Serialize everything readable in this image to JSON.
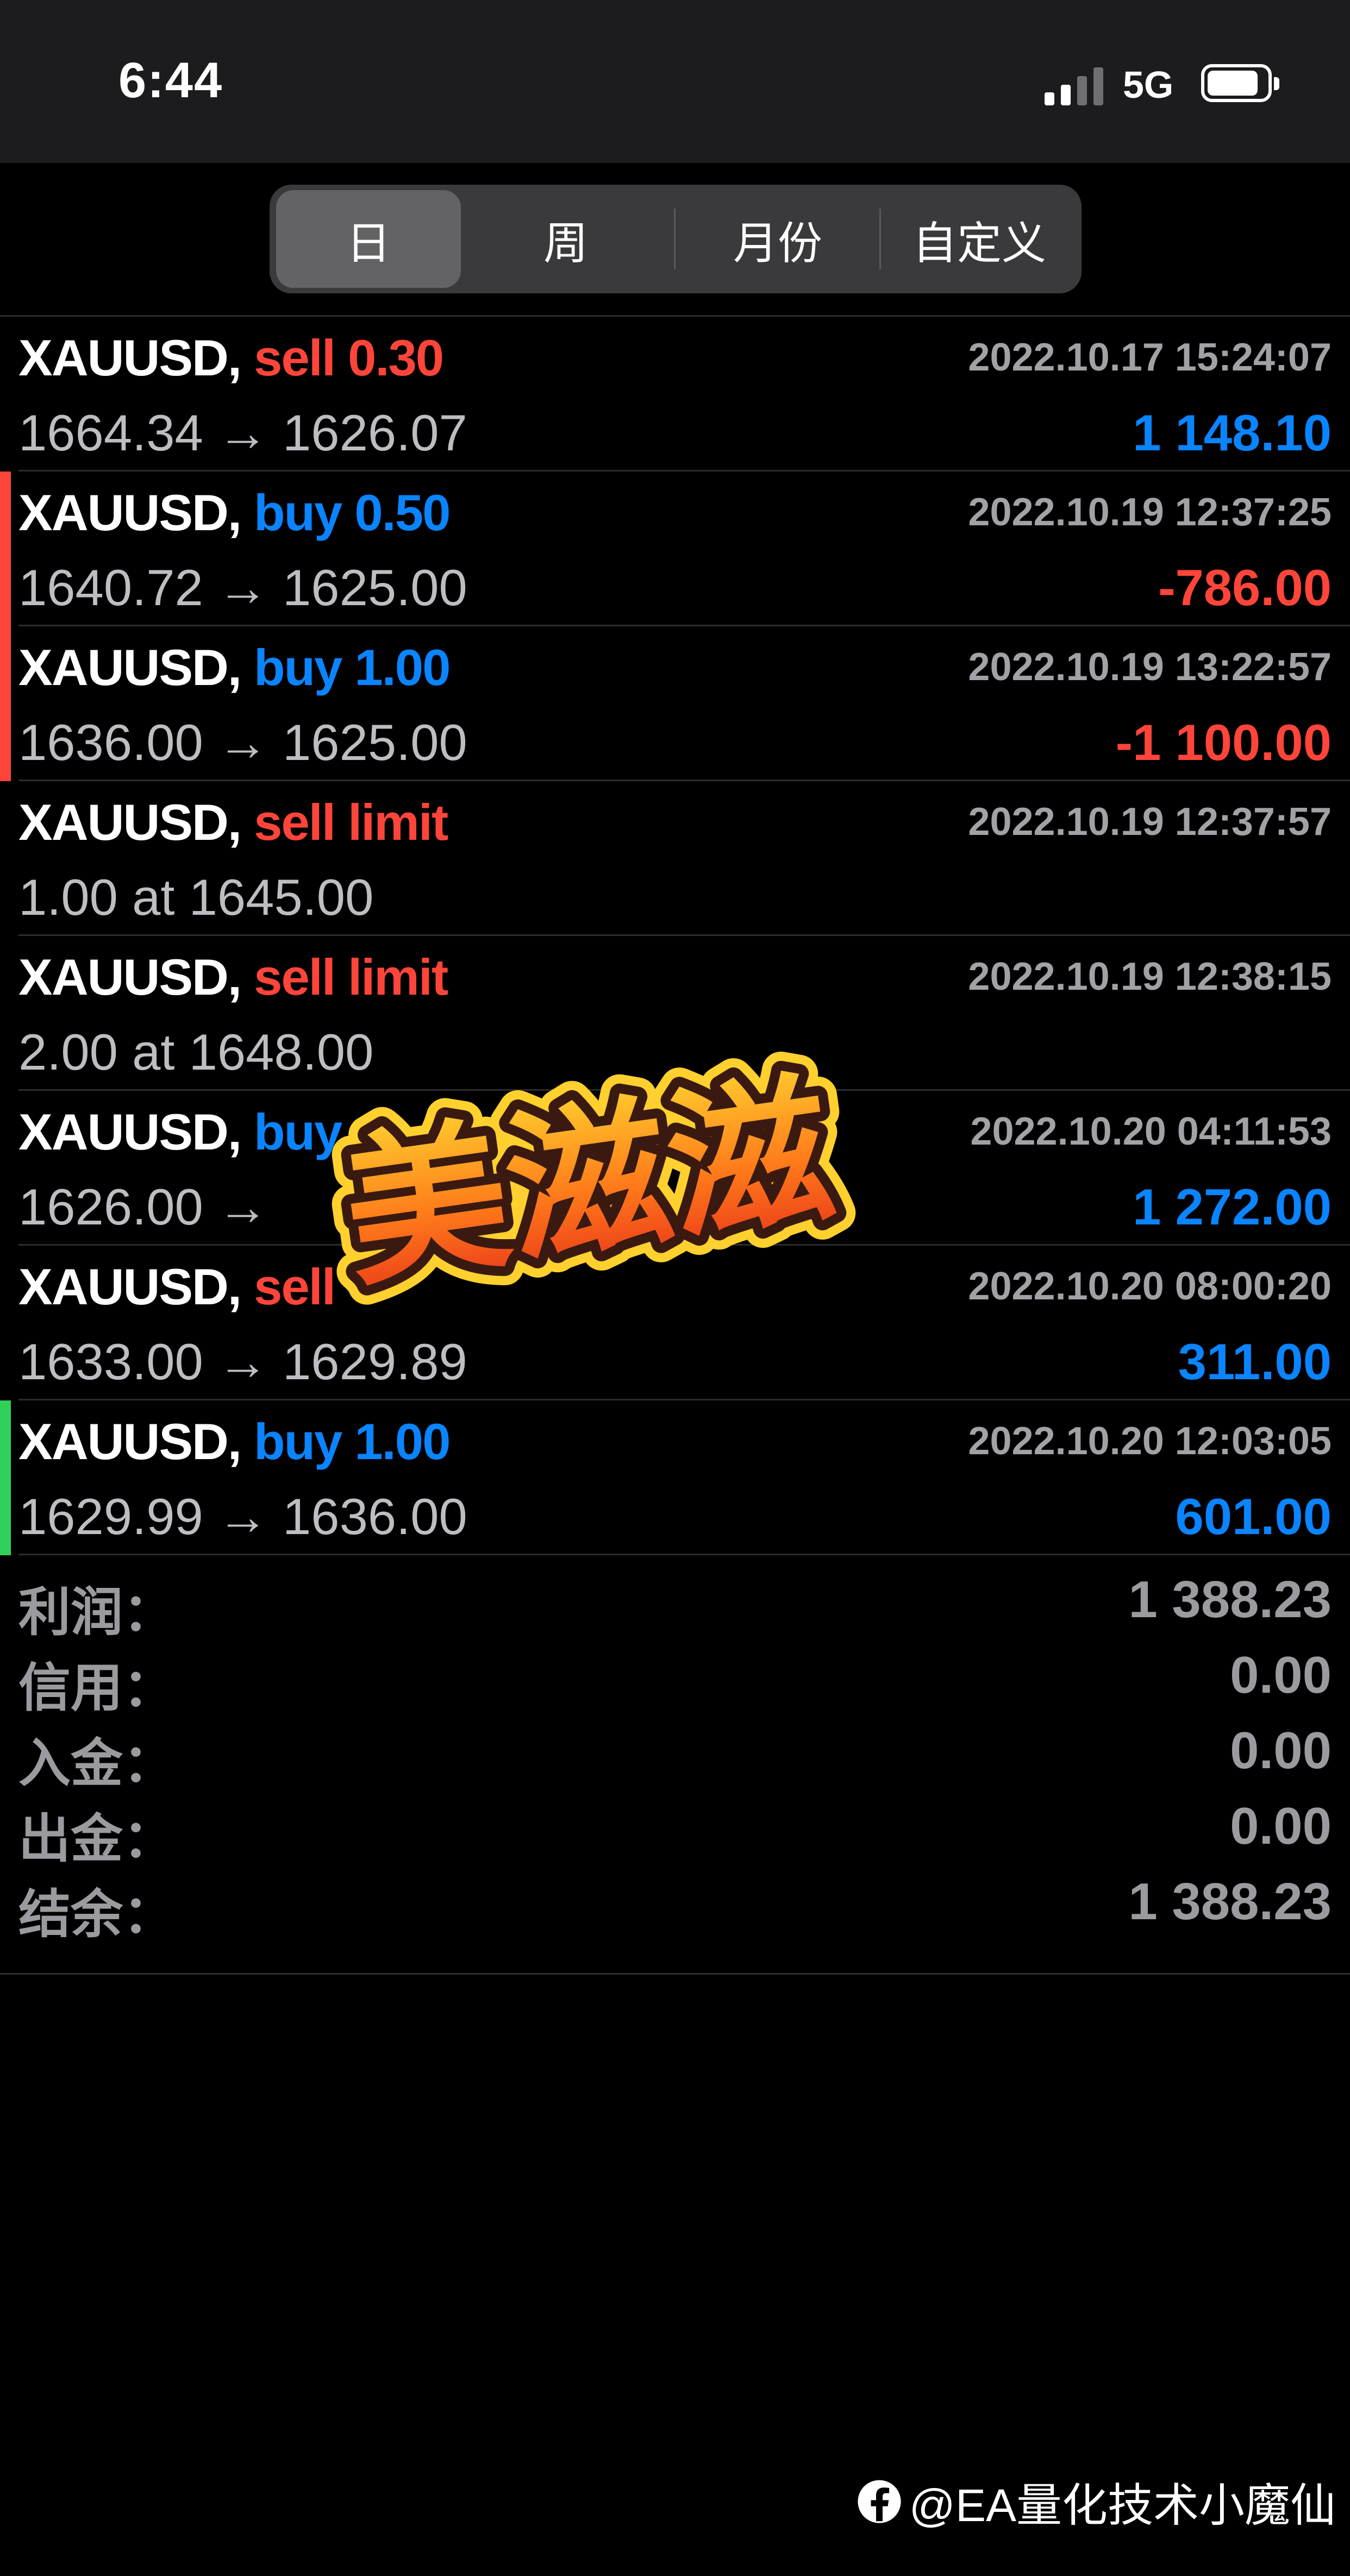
{
  "status_bar": {
    "time": "6:44",
    "network": "5G"
  },
  "segmented": {
    "tabs": [
      {
        "label": "日",
        "active": true
      },
      {
        "label": "周",
        "active": false
      },
      {
        "label": "月份",
        "active": false
      },
      {
        "label": "自定义",
        "active": false
      }
    ]
  },
  "deals": [
    {
      "symbol": "XAUUSD,",
      "action": "sell 0.30",
      "action_color": "red",
      "time": "2022.10.17 15:24:07",
      "prices": "1664.34 → 1626.07",
      "profit": "1 148.10",
      "profit_color": "blue",
      "bar": ""
    },
    {
      "symbol": "XAUUSD,",
      "action": "buy 0.50",
      "action_color": "blue",
      "time": "2022.10.19 12:37:25",
      "prices": "1640.72 → 1625.00",
      "profit": "-786.00",
      "profit_color": "red",
      "bar": "#ff453a"
    },
    {
      "symbol": "XAUUSD,",
      "action": "buy 1.00",
      "action_color": "blue",
      "time": "2022.10.19 13:22:57",
      "prices": "1636.00 → 1625.00",
      "profit": "-1 100.00",
      "profit_color": "red",
      "bar": "#ff453a"
    },
    {
      "symbol": "XAUUSD,",
      "action": "sell limit",
      "action_color": "red",
      "time": "2022.10.19 12:37:57",
      "prices": "1.00 at 1645.00",
      "profit": "",
      "profit_color": "blue",
      "bar": ""
    },
    {
      "symbol": "XAUUSD,",
      "action": "sell limit",
      "action_color": "red",
      "time": "2022.10.19 12:38:15",
      "prices": "2.00 at 1648.00",
      "profit": "",
      "profit_color": "blue",
      "bar": ""
    },
    {
      "symbol": "XAUUSD,",
      "action": "buy",
      "action_color": "blue",
      "time": "2022.10.20 04:11:53",
      "prices": "1626.00 →",
      "profit": "1 272.00",
      "profit_color": "blue",
      "bar": ""
    },
    {
      "symbol": "XAUUSD,",
      "action": "sell",
      "action_color": "red",
      "time": "2022.10.20 08:00:20",
      "prices": "1633.00 → 1629.89",
      "profit": "311.00",
      "profit_color": "blue",
      "bar": ""
    },
    {
      "symbol": "XAUUSD,",
      "action": "buy 1.00",
      "action_color": "blue",
      "time": "2022.10.20 12:03:05",
      "prices": "1629.99 → 1636.00",
      "profit": "601.00",
      "profit_color": "blue",
      "bar": "#30d158"
    }
  ],
  "summary": [
    {
      "label": "利润：",
      "value": "1 388.23"
    },
    {
      "label": "信用：",
      "value": "0.00"
    },
    {
      "label": "入金：",
      "value": "0.00"
    },
    {
      "label": "出金：",
      "value": "0.00"
    },
    {
      "label": "结余：",
      "value": "1 388.23"
    }
  ],
  "sticker": {
    "text": "美滋滋"
  },
  "watermark": {
    "text": "@EA量化技术小魔仙"
  },
  "colors": {
    "sell": "#ff453a",
    "buy": "#0a84ff",
    "win_bar": "#30d158",
    "loss_bar": "#ff453a"
  },
  "icons": [
    "signal-icon",
    "battery-icon",
    "facebook-icon"
  ]
}
